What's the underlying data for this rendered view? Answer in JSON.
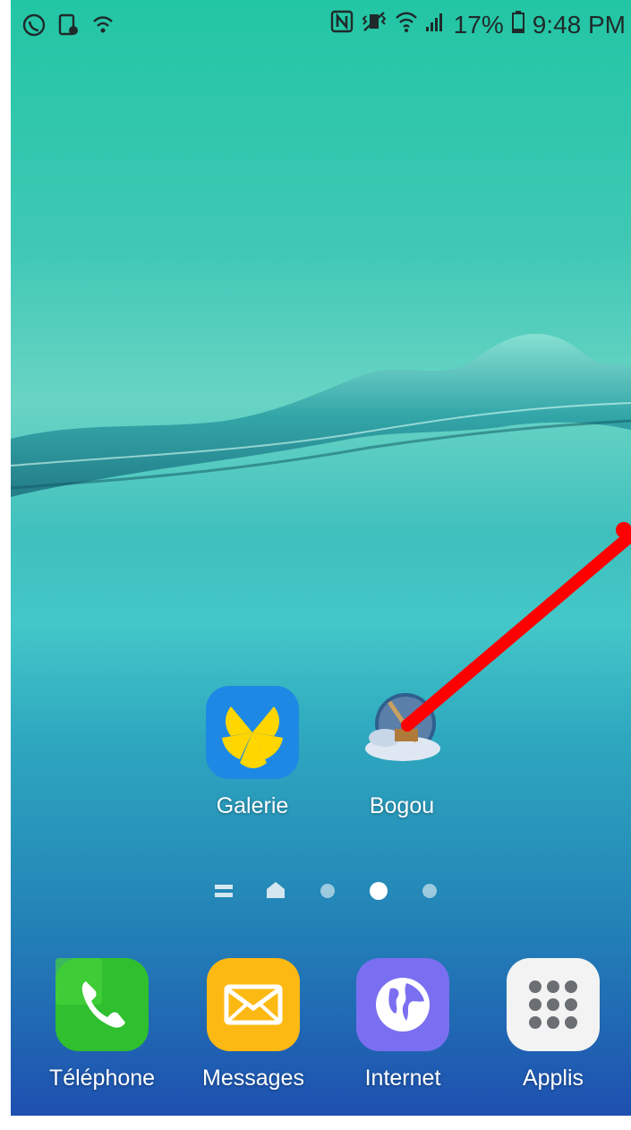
{
  "status_bar": {
    "battery_percent": "17%",
    "time": "9:48 PM",
    "battery_level": 0.17,
    "left_icons": [
      "viber-icon",
      "screenshot-icon",
      "wifi-hotspot-icon"
    ],
    "right_icons": [
      "nfc-icon",
      "vibrate-icon",
      "wifi-icon",
      "signal-icon",
      "battery-icon"
    ]
  },
  "home": {
    "apps": [
      {
        "label": "Galerie",
        "icon": "gallery-icon"
      },
      {
        "label": "Bogou",
        "icon": "bogou-icon"
      }
    ],
    "page_indicator": {
      "pages": 5,
      "active_index": 3,
      "icons": [
        "menu-icon",
        "home-icon"
      ]
    }
  },
  "dock": {
    "apps": [
      {
        "label": "Téléphone",
        "icon": "phone-icon",
        "color": "#2fbf2f"
      },
      {
        "label": "Messages",
        "icon": "envelope-icon",
        "color": "#fdb913"
      },
      {
        "label": "Internet",
        "icon": "globe-icon",
        "color": "#7a6ff0"
      },
      {
        "label": "Applis",
        "icon": "apps-grid-icon",
        "color": "#f3f3f3"
      }
    ]
  },
  "annotation": {
    "color": "#ff0000"
  }
}
